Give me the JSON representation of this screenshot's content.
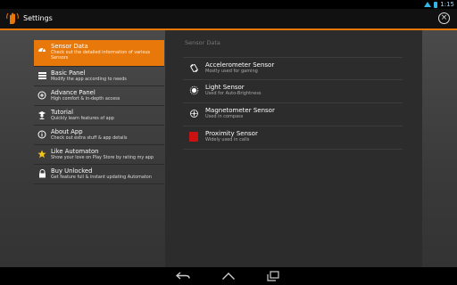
{
  "status_bar": {
    "time": "1:15"
  },
  "action_bar": {
    "title": "Settings"
  },
  "sidebar": {
    "items": [
      {
        "label": "Sensor Data",
        "sub": "Check out the detailed information of various Sensors",
        "icon": "speedometer-icon"
      },
      {
        "label": "Basic Panel",
        "sub": "Modify the app according to needs",
        "icon": "panel-icon"
      },
      {
        "label": "Advance Panel",
        "sub": "High comfort & in-depth access",
        "icon": "plus-icon"
      },
      {
        "label": "Tutorial",
        "sub": "Quickly learn features of app",
        "icon": "graduate-icon"
      },
      {
        "label": "About App",
        "sub": "Check out extra stuff & app details",
        "icon": "info-icon"
      },
      {
        "label": "Like Automaton",
        "sub": "Show your love on Play Store by rating my app",
        "icon": "star-icon"
      },
      {
        "label": "Buy Unlocked",
        "sub": "Get feature full & instant updating Automaton",
        "icon": "lock-icon"
      }
    ]
  },
  "panel": {
    "header": "Sensor Data",
    "sensors": [
      {
        "label": "Accelerometer Sensor",
        "sub": "Mostly used for gaming",
        "icon": "rotate-icon"
      },
      {
        "label": "Light Sensor",
        "sub": "Used for Auto-Brightness",
        "icon": "brightness-icon"
      },
      {
        "label": "Magnetometer Sensor",
        "sub": "Used in compass",
        "icon": "compass-icon"
      },
      {
        "label": "Proximity Sensor",
        "sub": "Widely used in calls",
        "icon": "proximity-icon"
      }
    ]
  },
  "colors": {
    "accent": "#e8780a",
    "status": "#33b5e5",
    "proximity": "#cc1111"
  }
}
